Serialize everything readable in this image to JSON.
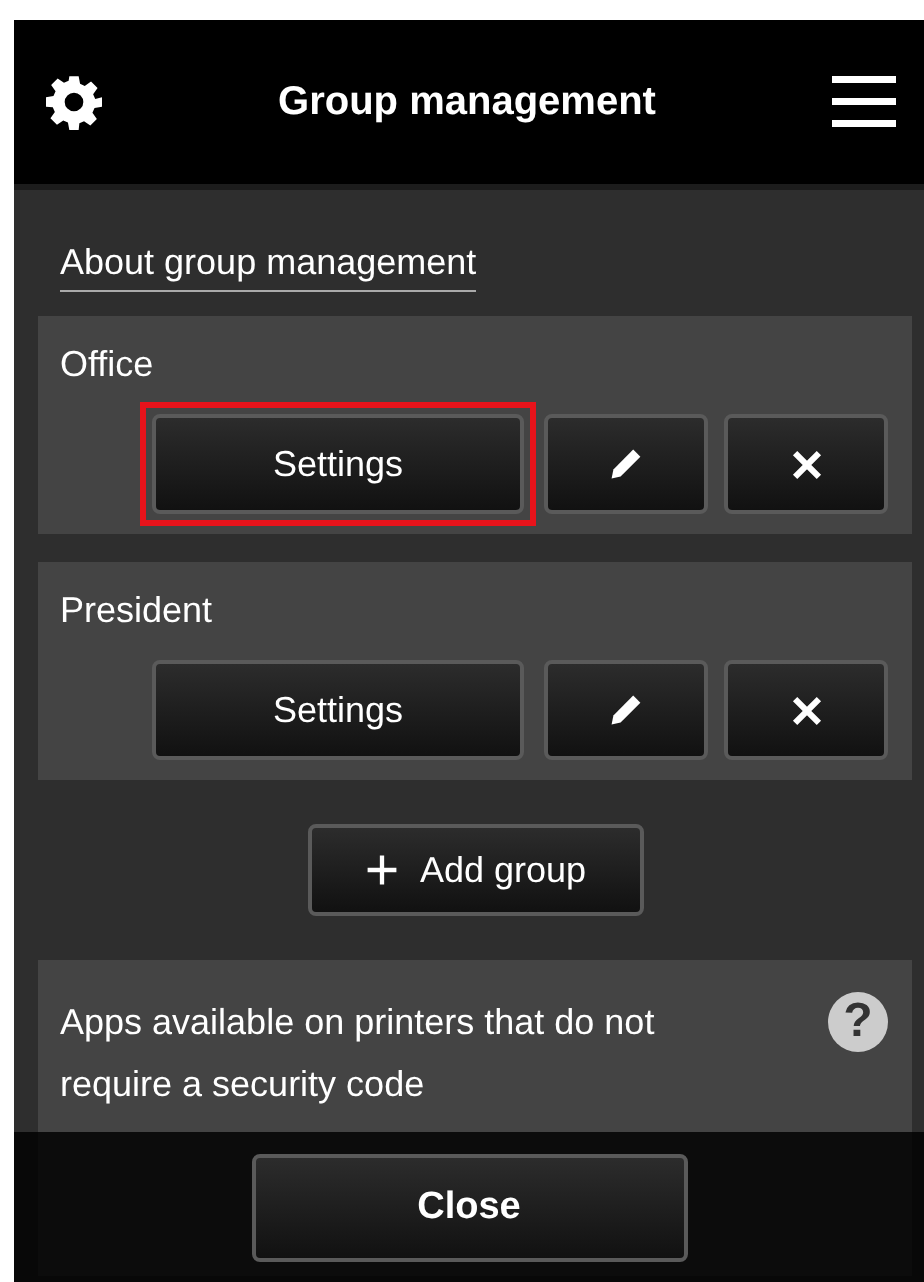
{
  "header": {
    "title": "Group management"
  },
  "about_link": "About group management",
  "groups": [
    {
      "name": "Office",
      "settings_button": "Settings",
      "highlighted": true
    },
    {
      "name": "President",
      "settings_button": "Settings",
      "highlighted": false
    }
  ],
  "add_group_button": "Add group",
  "apps_section": {
    "text": "Apps available on printers that do not require a security code",
    "help": "?"
  },
  "footer": {
    "close_button": "Close"
  }
}
